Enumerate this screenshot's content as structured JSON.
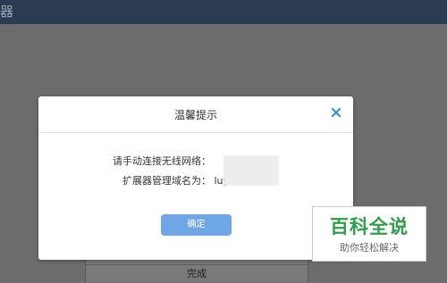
{
  "topbar": {
    "text": "器"
  },
  "background": {
    "finish_label": "完成"
  },
  "dialog": {
    "title": "温馨提示",
    "close_icon": "close-icon",
    "line1": "请手动连接无线网络：",
    "line2_label": "扩展器管理域名为：",
    "line2_value": "luyou.",
    "ok_label": "确定"
  },
  "watermark": {
    "main": "百科全说",
    "sub": "助你轻松解决"
  },
  "colors": {
    "topbar": "#2b3b52",
    "overlay": "#6c6c6c",
    "button": "#6fa6e6",
    "close": "#3d8fe0",
    "watermark_green": "#2da04a"
  }
}
